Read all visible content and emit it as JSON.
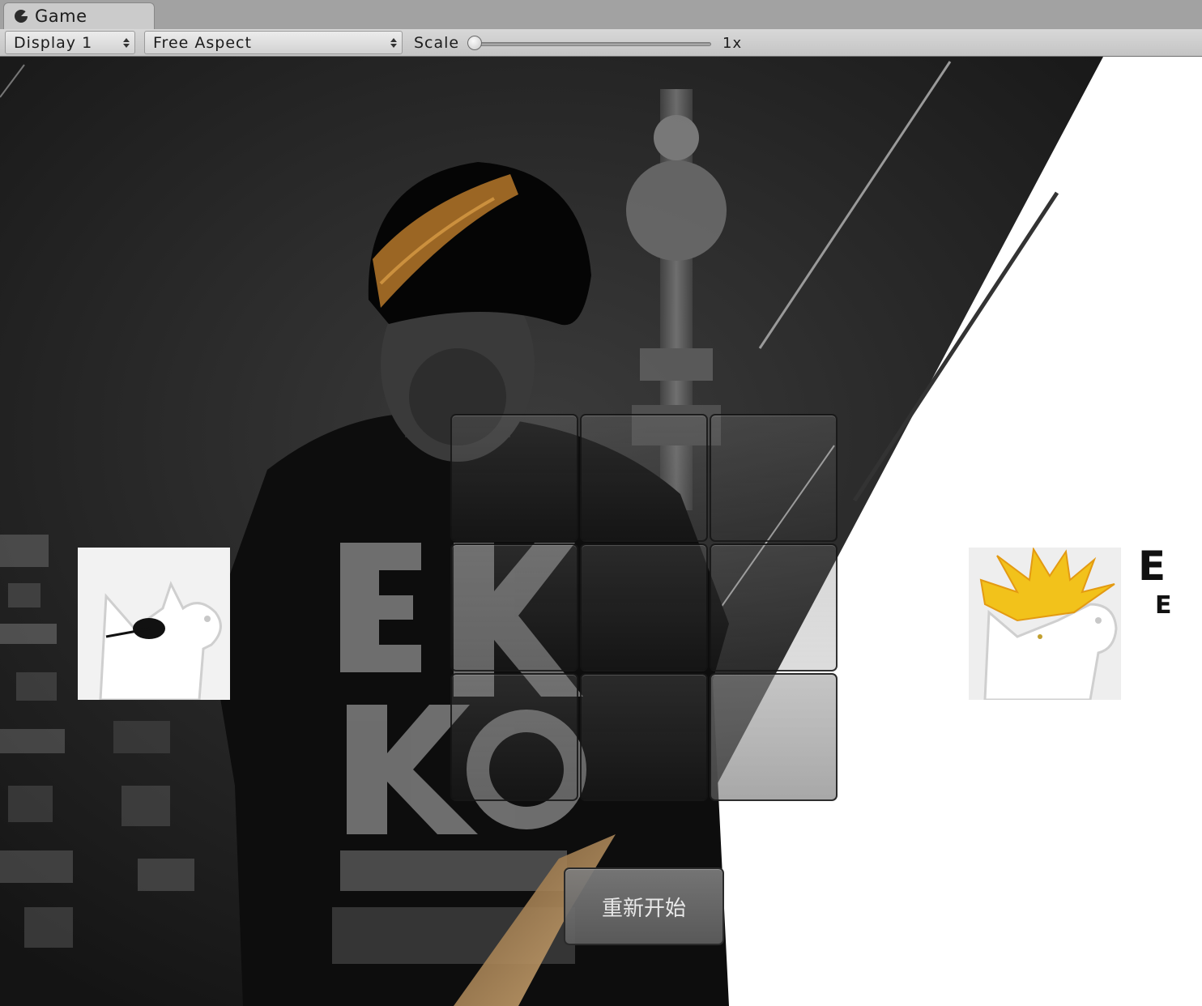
{
  "window": {
    "tab_title": "Game",
    "tab_icon": "pacman-icon"
  },
  "toolbar": {
    "display_select": "Display 1",
    "aspect_select": "Free Aspect",
    "scale_label": "Scale",
    "scale_value": "1x",
    "scale_level": 0.0
  },
  "game": {
    "restart_label": "重新开始",
    "brand_title": "E A",
    "brand_subtitle": "E D",
    "puzzle": {
      "rows": 3,
      "cols": 3,
      "empty_tile": 8
    },
    "colors": {
      "background_dark": "#1b1b1b",
      "diagonal_white": "#ffffff",
      "hair_accent": "#c98a2c",
      "hair_yellow": "#f2c21b"
    }
  }
}
